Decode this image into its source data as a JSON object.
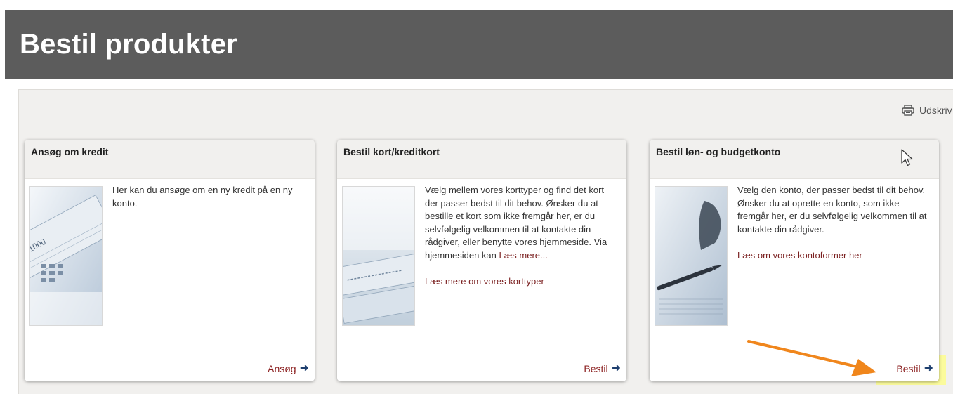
{
  "header": {
    "title": "Bestil produkter"
  },
  "toolbar": {
    "print_label": "Udskriv",
    "print_icon": "printer-icon"
  },
  "cards": [
    {
      "title": "Ansøg om kredit",
      "text": "Her kan du ansøge om en ny kredit på en ny konto.",
      "action_label": "Ansøg",
      "action_icon": "arrow-right-icon",
      "image": "banknotes-calculator-image"
    },
    {
      "title": "Bestil kort/kreditkort",
      "text": "Vælg mellem vores korttyper og find det kort der passer bedst til dit behov. Ønsker du at bestille et kort som ikke fremgår her, er du selvfølgelig velkommen til at kontakte din rådgiver, eller benytte vores hjemmeside. Via hjemmesiden kan",
      "inline_link": "Læs mere...",
      "more_link": "Læs mere om vores korttyper",
      "action_label": "Bestil",
      "action_icon": "arrow-right-icon",
      "image": "credit-cards-image"
    },
    {
      "title": "Bestil løn- og budgetkonto",
      "text": "Vælg den konto, der passer bedst til dit behov. Ønsker du at oprette en konto, som ikke fremgår her, er du selvfølgelig velkommen til at kontakte din rådgiver.",
      "more_link": "Læs om vores kontoformer her",
      "action_label": "Bestil",
      "action_icon": "arrow-right-icon",
      "image": "pen-document-image"
    }
  ],
  "annotations": {
    "highlight_color": "#fbfb9c",
    "arrow_color": "#f0861c"
  },
  "colors": {
    "header_bg": "#5c5c5c",
    "panel_bg": "#f1f0ee",
    "link": "#7a1f1f",
    "arrow": "#1d3e6e"
  }
}
